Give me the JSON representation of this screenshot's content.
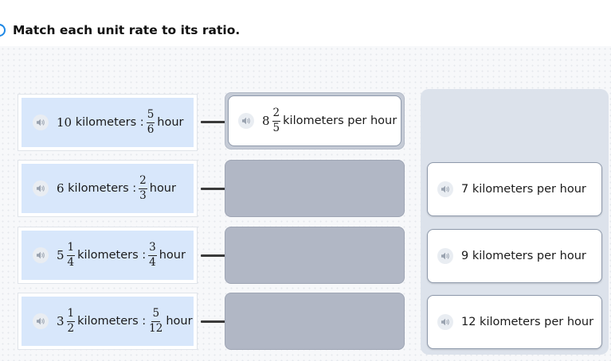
{
  "prompt": "Match each unit rate to its ratio.",
  "rows": [
    {
      "ratio": {
        "dist_whole": "10",
        "dist_label": "kilometers :",
        "time_num": "5",
        "time_den": "6",
        "time_label": "hour"
      },
      "matched": {
        "whole": "8",
        "num": "2",
        "den": "5",
        "label": "kilometers per hour"
      }
    },
    {
      "ratio": {
        "dist_whole": "6",
        "dist_label": "kilometers :",
        "time_num": "2",
        "time_den": "3",
        "time_label": "hour"
      }
    },
    {
      "ratio": {
        "dist_whole": "5",
        "dist_num": "1",
        "dist_den": "4",
        "dist_label": "kilometers :",
        "time_num": "3",
        "time_den": "4",
        "time_label": "hour"
      }
    },
    {
      "ratio": {
        "dist_whole": "3",
        "dist_num": "1",
        "dist_den": "2",
        "dist_label": "kilometers :",
        "time_num": "5",
        "time_den": "12",
        "time_label": "hour"
      }
    }
  ],
  "answer_bank": [
    {
      "label": "7 kilometers per hour"
    },
    {
      "label": "9 kilometers per hour"
    },
    {
      "label": "12 kilometers per hour"
    }
  ],
  "icons": {
    "speaker": "speaker-icon"
  },
  "colors": {
    "ratio_fill": "#d8e7fb",
    "empty_slot": "#b1b7c5",
    "bank_bg": "#dce2eb",
    "audio_accent": "#1e88e5"
  }
}
